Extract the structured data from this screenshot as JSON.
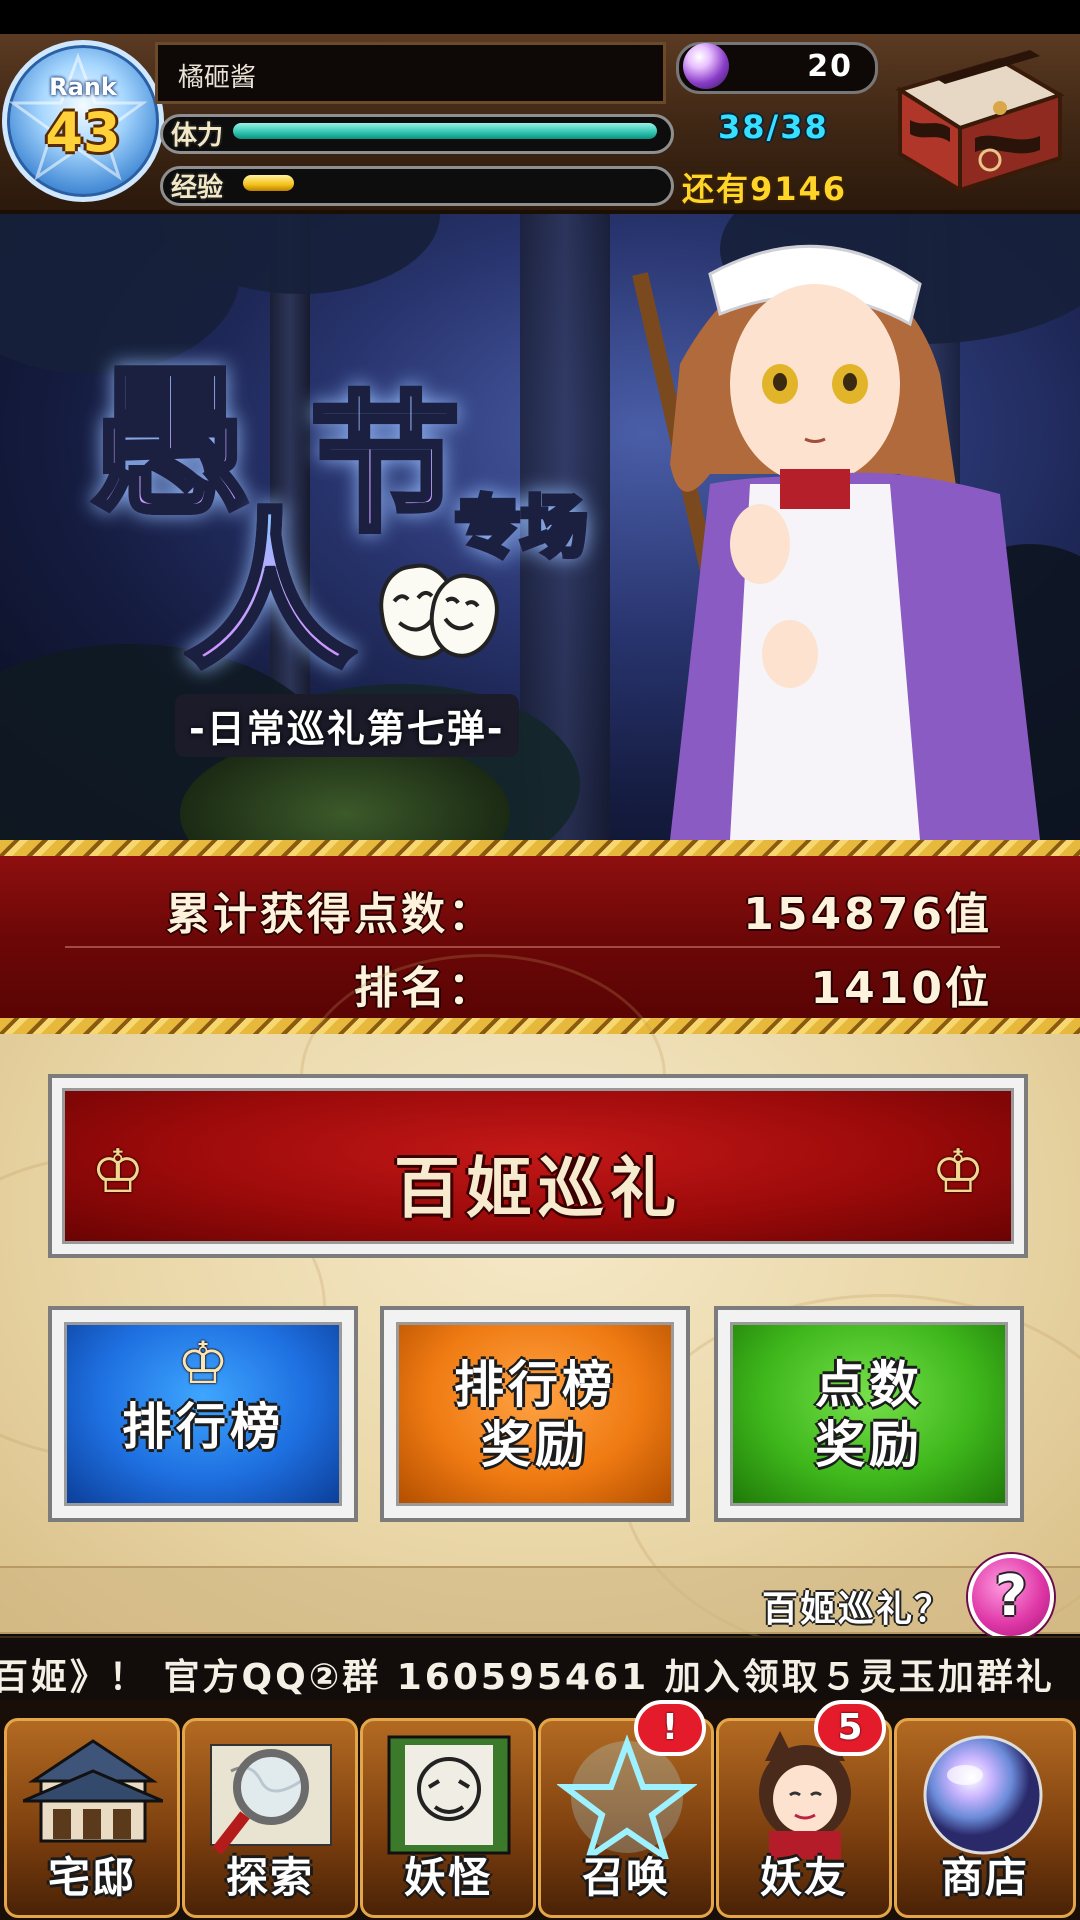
{
  "header": {
    "rank_label": "Rank",
    "rank_value": "43",
    "player_name": "橘砸酱",
    "stamina_label": "体力",
    "stamina_value": "38/38",
    "stamina_fraction": 1.0,
    "exp_label": "经验",
    "exp_remaining": "还有9146",
    "exp_fraction": 0.12,
    "orb_count": "20",
    "icons": {
      "rank": "pentagram-badge-icon",
      "orb": "spirit-orb-icon",
      "chest": "treasure-chest-icon"
    }
  },
  "banner": {
    "title_chars": [
      "愚",
      "人",
      "节"
    ],
    "title_suffix": "专场",
    "subtitle": "-日常巡礼第七弹-"
  },
  "stats": {
    "points_label": "累计获得点数：",
    "points_value": "154876值",
    "rank_label": "排名：",
    "rank_value": "1410位"
  },
  "main_button": {
    "label": "百姬巡礼",
    "icon": "crown-icon"
  },
  "sub_buttons": [
    {
      "lines": [
        "排行榜"
      ],
      "color": "#1e6fe0",
      "icon": "crown-icon"
    },
    {
      "lines": [
        "排行榜",
        "奖励"
      ],
      "color": "#ef7a12"
    },
    {
      "lines": [
        "点数",
        "奖励"
      ],
      "color": "#3fb81c"
    }
  ],
  "help": {
    "text": "百姬巡礼？",
    "glyph": "?"
  },
  "ticker": {
    "text": "百姬》！ 官方QQ②群 160595461  加入领取５灵玉加群礼"
  },
  "nav": [
    {
      "label": "宅邸",
      "icon": "mansion-icon"
    },
    {
      "label": "探索",
      "icon": "magnifier-map-icon"
    },
    {
      "label": "妖怪",
      "icon": "yokai-scroll-icon"
    },
    {
      "label": "召唤",
      "icon": "pentagram-summon-icon",
      "badge": "!"
    },
    {
      "label": "妖友",
      "icon": "fox-girl-friend-icon",
      "badge": "5"
    },
    {
      "label": "商店",
      "icon": "crystal-orb-shop-icon"
    }
  ]
}
